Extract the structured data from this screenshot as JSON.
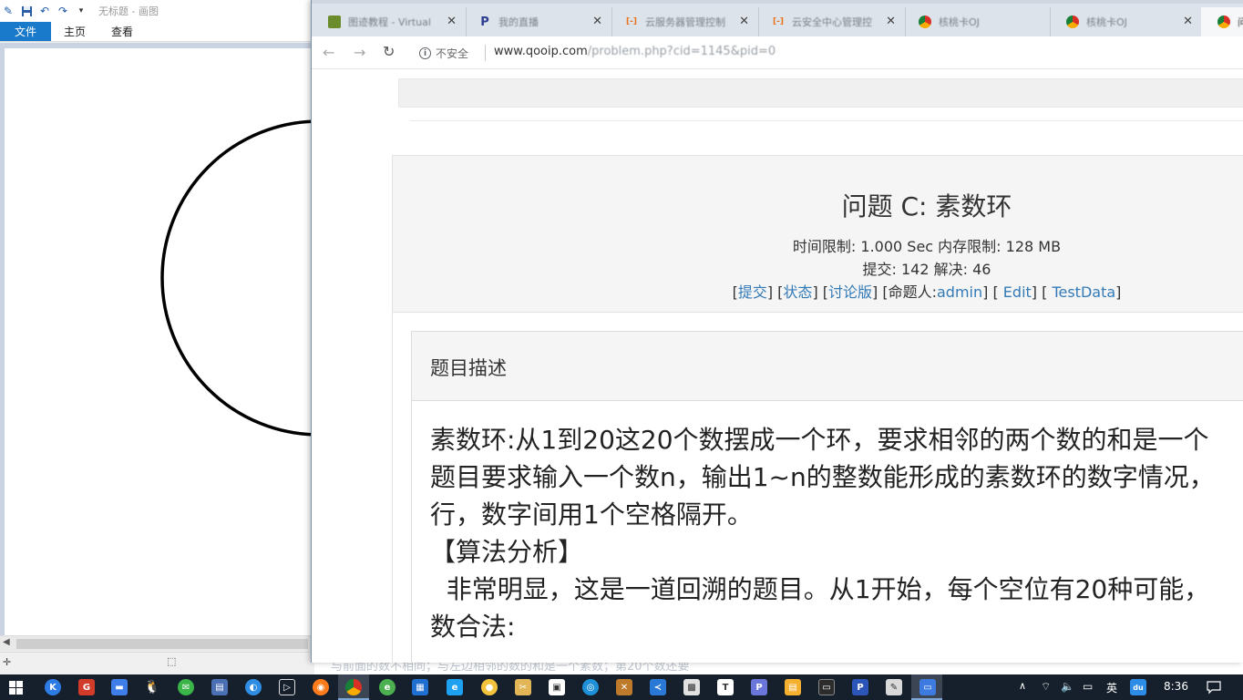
{
  "paint": {
    "title": "无标题 - 画图",
    "tabs": [
      "文件",
      "主页",
      "查看"
    ]
  },
  "chrome": {
    "tabs": [
      {
        "title": "图迹教程 - Virtual",
        "icon": "shortcut",
        "color": "#6a8c2b"
      },
      {
        "title": "我的直播",
        "icon": "P",
        "color": "#2d3c91"
      },
      {
        "title": "云服务器管理控制",
        "icon": "[-]",
        "color": "#e8711a"
      },
      {
        "title": "云安全中心管理控",
        "icon": "[-]",
        "color": "#e8711a"
      },
      {
        "title": "核桃卡OJ",
        "icon": "chrome",
        "color": "#d93025"
      },
      {
        "title": "核桃卡OJ",
        "icon": "chrome",
        "color": "#d93025"
      },
      {
        "title": "问",
        "icon": "chrome",
        "color": "#d93025"
      }
    ],
    "secure_label": "不安全",
    "url_host": "www.qooip.com",
    "url_path": "/problem.php?cid=1145&pid=0"
  },
  "problem": {
    "title": "问题 C: 素数环",
    "limits": "时间限制: 1.000 Sec  内存限制: 128 MB",
    "stats": "提交: 142  解决: 46",
    "links": {
      "submit": "提交",
      "status": "状态",
      "forum": "讨论版",
      "author_prefix": "[命题人:",
      "author": "admin",
      "edit": "Edit",
      "testdata": "TestData"
    },
    "section_header": "题目描述",
    "lines": [
      "素数环:从1到20这20个数摆成一个环，要求相邻的两个数的和是一个",
      "题目要求输入一个数n，输出1~n的整数能形成的素数环的数字情况，",
      "行，数字间用1个空格隔开。",
      "【算法分析】",
      "  非常明显，这是一道回溯的题目。从1开始，每个空位有20种可能，",
      "数合法:"
    ]
  },
  "covered_text": "与前面的数不相同；与左边相邻的数的和是一个素数；第20个数还要",
  "tray": {
    "ime": "英",
    "time": "8:36"
  }
}
